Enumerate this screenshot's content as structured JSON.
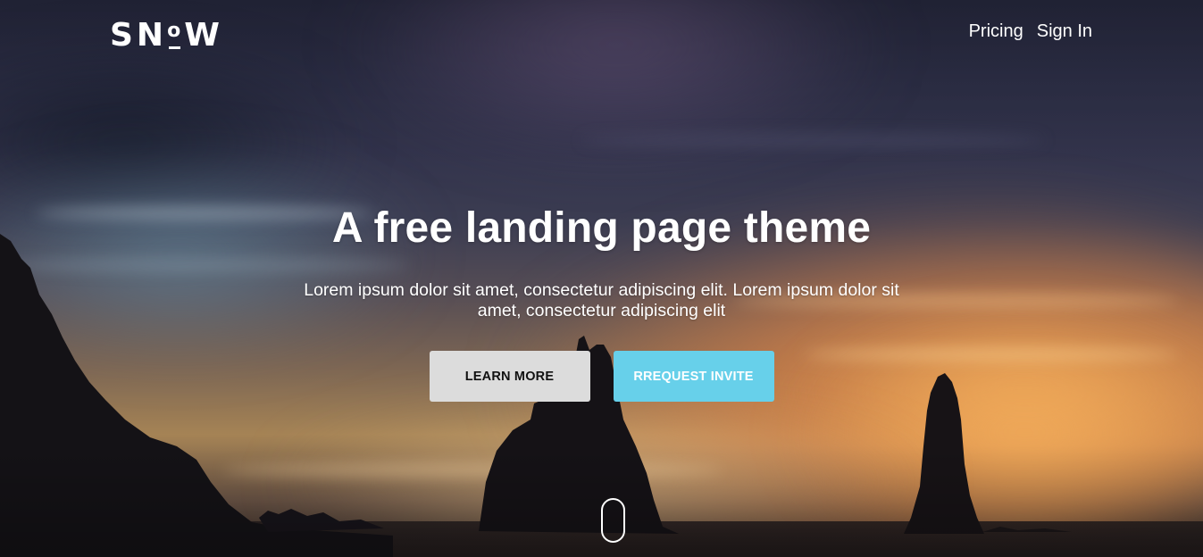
{
  "header": {
    "logo": {
      "letters_before": "SN",
      "letter_o": "o",
      "letters_after": "W"
    },
    "nav": [
      {
        "label": "Pricing"
      },
      {
        "label": "Sign In"
      }
    ]
  },
  "hero": {
    "title": "A free landing page theme",
    "subtitle": "Lorem ipsum dolor sit amet, consectetur adipiscing elit. Lorem ipsum dolor sit amet, consectetur adipiscing elit",
    "buttons": {
      "learn_more": "LEARN MORE",
      "request_invite": "RREQUEST INVITE"
    },
    "scroll_indicator_icon": "mouse-scroll-icon"
  },
  "colors": {
    "primary_button": "#67d0ea",
    "secondary_button": "#dcdcdc",
    "text": "#ffffff"
  }
}
